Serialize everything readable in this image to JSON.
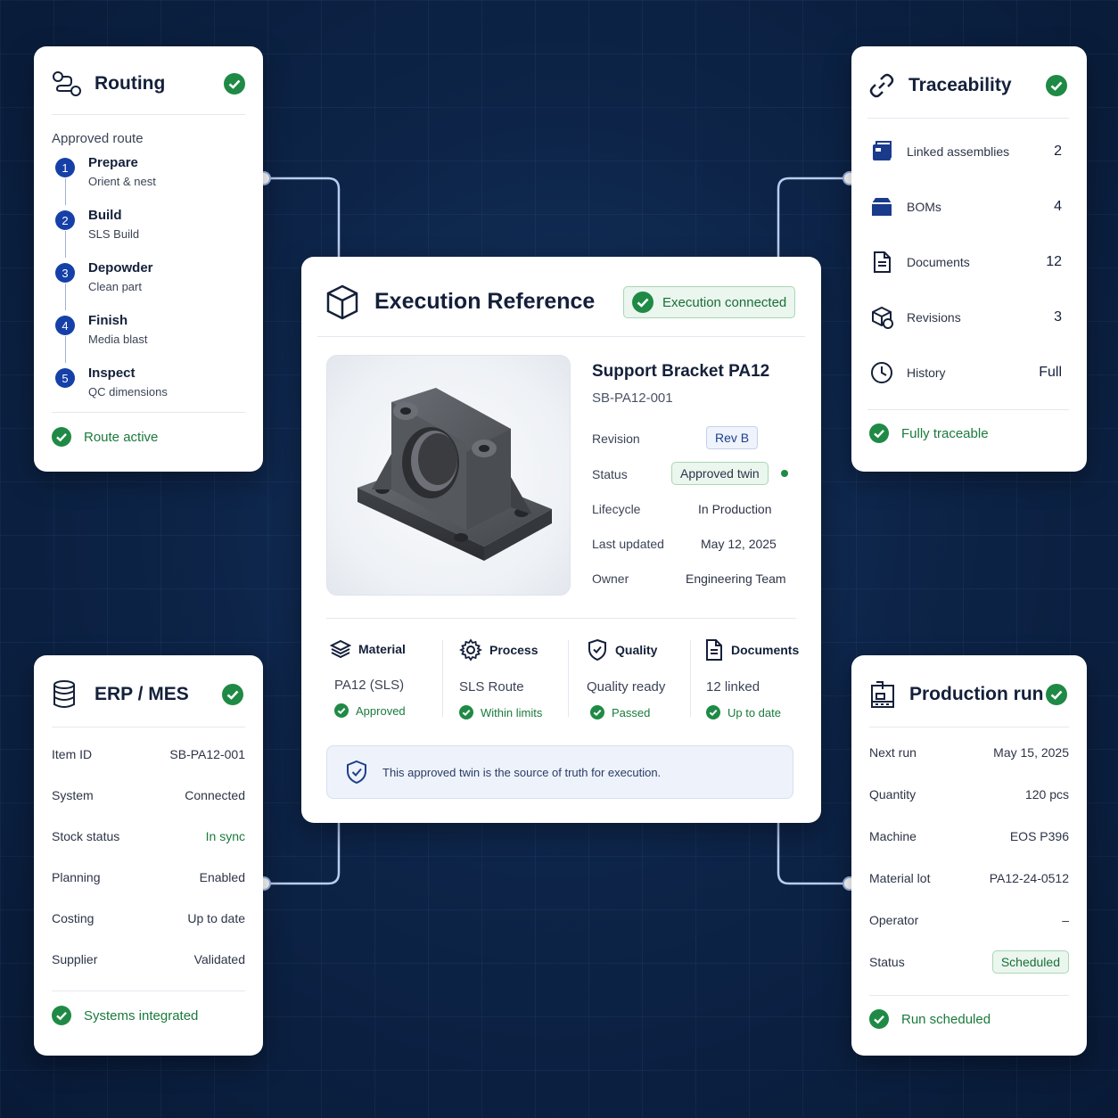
{
  "colors": {
    "background": "#0d2448",
    "accent_blue": "#1640a8",
    "success_green": "#1f8a45",
    "success_text": "#1a7a3c"
  },
  "routing": {
    "title": "Routing",
    "subtitle": "Approved route",
    "steps": [
      {
        "num": "1",
        "name": "Prepare",
        "desc": "Orient & nest"
      },
      {
        "num": "2",
        "name": "Build",
        "desc": "SLS Build"
      },
      {
        "num": "3",
        "name": "Depowder",
        "desc": "Clean part"
      },
      {
        "num": "4",
        "name": "Finish",
        "desc": "Media blast"
      },
      {
        "num": "5",
        "name": "Inspect",
        "desc": "QC dimensions"
      }
    ],
    "footer": "Route active"
  },
  "traceability": {
    "title": "Traceability",
    "rows": [
      {
        "icon": "assembly-icon",
        "label": "Linked assemblies",
        "value": "2"
      },
      {
        "icon": "folder-icon",
        "label": "BOMs",
        "value": "4"
      },
      {
        "icon": "document-icon",
        "label": "Documents",
        "value": "12"
      },
      {
        "icon": "revision-icon",
        "label": "Revisions",
        "value": "3"
      },
      {
        "icon": "clock-icon",
        "label": "History",
        "value": "Full"
      }
    ],
    "footer": "Fully traceable"
  },
  "erp": {
    "title": "ERP / MES",
    "rows": [
      {
        "label": "Item ID",
        "value": "SB-PA12-001"
      },
      {
        "label": "System",
        "value": "Connected"
      },
      {
        "label": "Stock status",
        "value": "In sync"
      },
      {
        "label": "Planning",
        "value": "Enabled"
      },
      {
        "label": "Costing",
        "value": "Up to date"
      },
      {
        "label": "Supplier",
        "value": "Validated"
      }
    ],
    "footer": "Systems integrated"
  },
  "production": {
    "title": "Production run",
    "rows": [
      {
        "label": "Next run",
        "value": "May 15, 2025"
      },
      {
        "label": "Quantity",
        "value": "120 pcs"
      },
      {
        "label": "Machine",
        "value": "EOS P396"
      },
      {
        "label": "Material lot",
        "value": "PA12-24-0512"
      },
      {
        "label": "Operator",
        "value": "–"
      },
      {
        "label": "Status",
        "value": "Scheduled"
      }
    ],
    "footer": "Run scheduled"
  },
  "center": {
    "title": "Execution Reference",
    "connection_badge": "Execution connected",
    "part_name": "Support Bracket PA12",
    "part_number": "SB-PA12-001",
    "properties": {
      "revision_label": "Revision",
      "revision_value": "Rev B",
      "status_label": "Status",
      "status_value": "Approved twin",
      "lifecycle_label": "Lifecycle",
      "lifecycle_value": "In Production",
      "updated_label": "Last updated",
      "updated_value": "May 12, 2025",
      "owner_label": "Owner",
      "owner_value": "Engineering Team"
    },
    "summary": [
      {
        "icon": "layers-icon",
        "title": "Material",
        "value": "PA12 (SLS)",
        "status": "Approved"
      },
      {
        "icon": "gear-icon",
        "title": "Process",
        "value": "SLS Route",
        "status": "Within limits"
      },
      {
        "icon": "shield-check-icon",
        "title": "Quality",
        "value": "Quality ready",
        "status": "Passed"
      },
      {
        "icon": "document-icon",
        "title": "Documents",
        "value": "12 linked",
        "status": "Up to date"
      }
    ],
    "note": "This approved twin is the source of truth for execution."
  }
}
